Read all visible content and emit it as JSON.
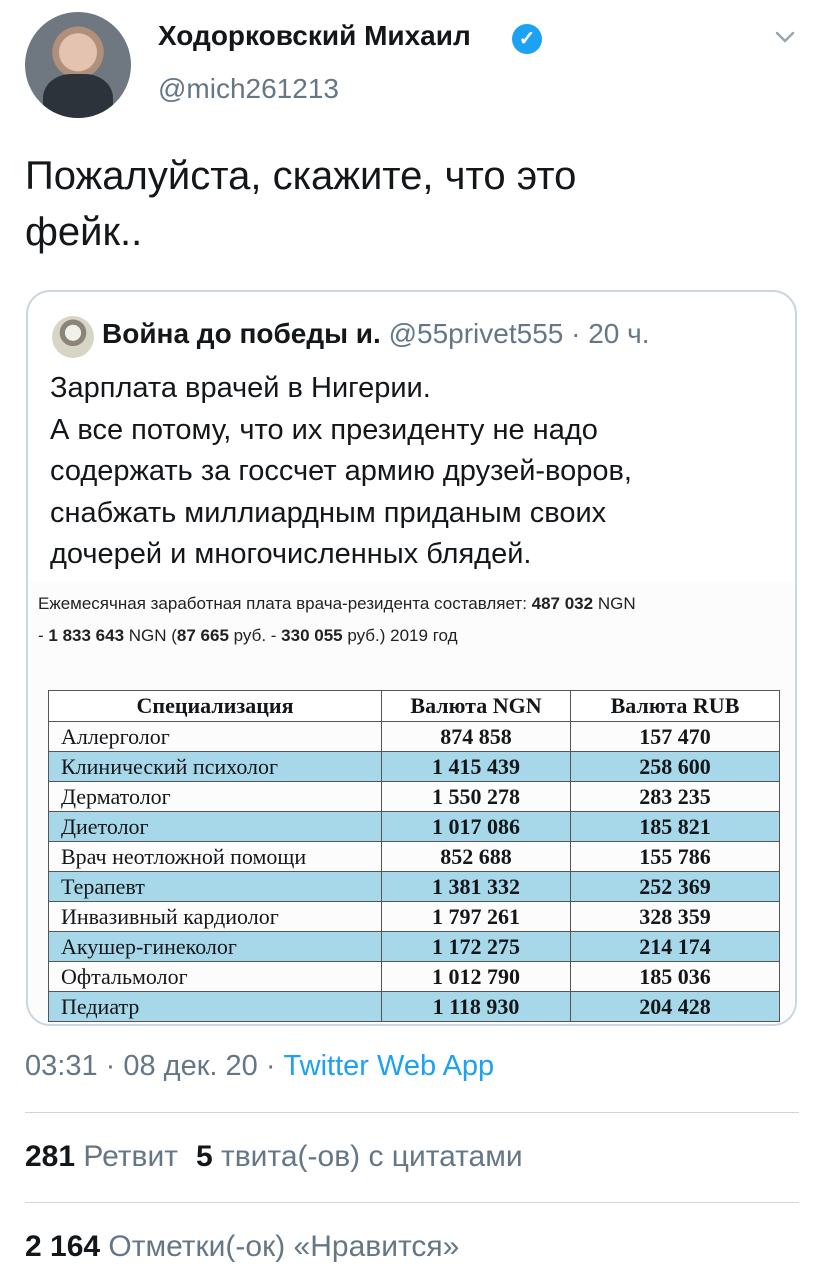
{
  "tweet": {
    "author_name": "Ходорковский Михаил",
    "author_handle": "@mich261213",
    "text_line1": "Пожалуйста, скажите, что это",
    "text_line2": "фейк..",
    "timestamp": "03:31 · 08 дек. 20 · ",
    "source": "Twitter Web App",
    "retweets_count": "281",
    "retweets_label": "Ретвит",
    "quotes_count": "5",
    "quotes_label": "твита(-ов) с цитатами",
    "likes_count": "2 164",
    "likes_label": "Отметки(-ок) «Нравится»"
  },
  "quoted": {
    "author_name": "Война до победы и.",
    "meta": "@55privet555 · 20 ч.",
    "lines": [
      "Зарплата врачей в Нигерии.",
      "А все потому, что их президенту не надо",
      "содержать за госсчет армию друзей-воров,",
      "снабжать миллиардным приданым своих",
      "дочерей и многочисленных блядей."
    ]
  },
  "image": {
    "line1_text": "Ежемесячная заработная плата врача-резидента составляет: ",
    "line1_bold": "487 032",
    "line1_tail": " NGN",
    "line2_dash": "- ",
    "line2_bold1": "1 833 643",
    "line2_mid": " NGN (",
    "line2_bold2": "87 665",
    "line2_mid2": " руб. - ",
    "line2_bold3": "330 055",
    "line2_tail": " руб.) 2019 год",
    "table": {
      "headers": [
        "Специализация",
        "Валюта NGN",
        "Валюта RUB"
      ],
      "rows": [
        [
          "Аллерголог",
          "874 858",
          "157 470"
        ],
        [
          "Клинический психолог",
          "1 415 439",
          "258 600"
        ],
        [
          "Дерматолог",
          "1 550 278",
          "283 235"
        ],
        [
          "Диетолог",
          "1 017 086",
          "185 821"
        ],
        [
          "Врач неотложной помощи",
          "852 688",
          "155 786"
        ],
        [
          "Терапевт",
          "1 381 332",
          "252 369"
        ],
        [
          "Инвазивный кардиолог",
          "1 797 261",
          "328 359"
        ],
        [
          "Акушер-гинеколог",
          "1 172 275",
          "214 174"
        ],
        [
          "Офтальмолог",
          "1 012 790",
          "185 036"
        ],
        [
          "Педиатр",
          "1 118 930",
          "204 428"
        ]
      ]
    }
  },
  "colors": {
    "accent": "#1da1f2",
    "secondary_text": "#657786",
    "row_highlight": "#a7d8ea"
  },
  "icons": [
    "verified-badge-icon",
    "chevron-down-icon"
  ]
}
